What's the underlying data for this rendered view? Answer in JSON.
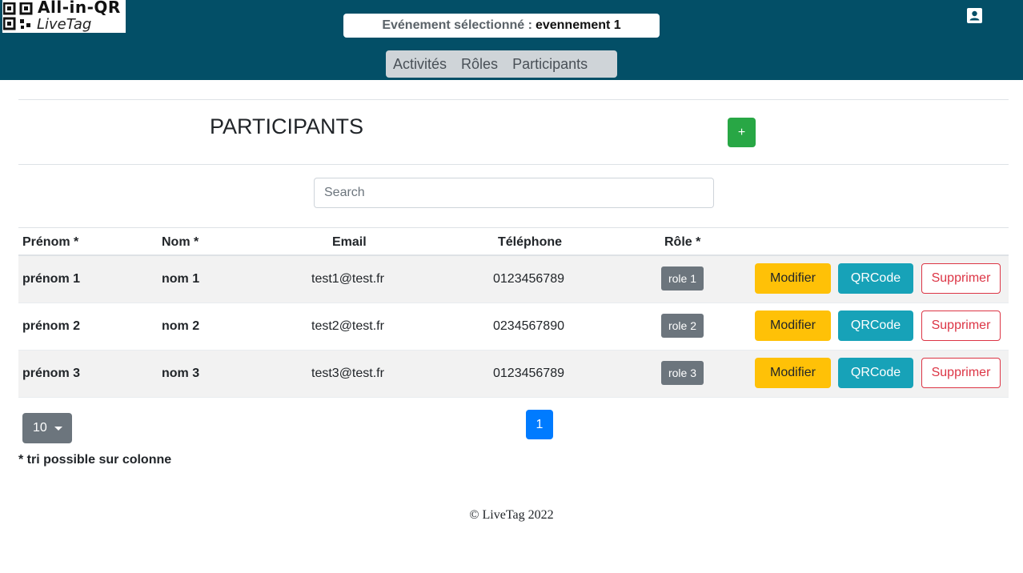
{
  "header": {
    "logo_main": "All-in-QR",
    "logo_sub": "LiveTag",
    "event_label": "Evénement sélectionné :",
    "event_value": "evennement 1",
    "nav": [
      "Activités",
      "Rôles",
      "Participants"
    ]
  },
  "page": {
    "title": "PARTICIPANTS",
    "add_label": "+",
    "search_placeholder": "Search"
  },
  "table": {
    "headers": [
      "Prénom *",
      "Nom *",
      "Email",
      "Téléphone",
      "Rôle *"
    ],
    "rows": [
      {
        "prenom": "prénom 1",
        "nom": "nom 1",
        "email": "test1@test.fr",
        "tel": "0123456789",
        "role": "role 1"
      },
      {
        "prenom": "prénom 2",
        "nom": "nom 2",
        "email": "test2@test.fr",
        "tel": "0234567890",
        "role": "role 2"
      },
      {
        "prenom": "prénom 3",
        "nom": "nom 3",
        "email": "test3@test.fr",
        "tel": "0123456789",
        "role": "role 3"
      }
    ],
    "actions": {
      "modify": "Modifier",
      "qr": "QRCode",
      "delete": "Supprimer"
    }
  },
  "pagination": {
    "page_size": "10",
    "current_page": "1"
  },
  "note": "* tri possible sur colonne",
  "footer": "© LiveTag 2022",
  "colors": {
    "header_bg": "#034f67",
    "add": "#28a745",
    "modify": "#ffc107",
    "qr": "#17a2b8",
    "delete": "#dc3545",
    "page_active": "#007bff"
  }
}
